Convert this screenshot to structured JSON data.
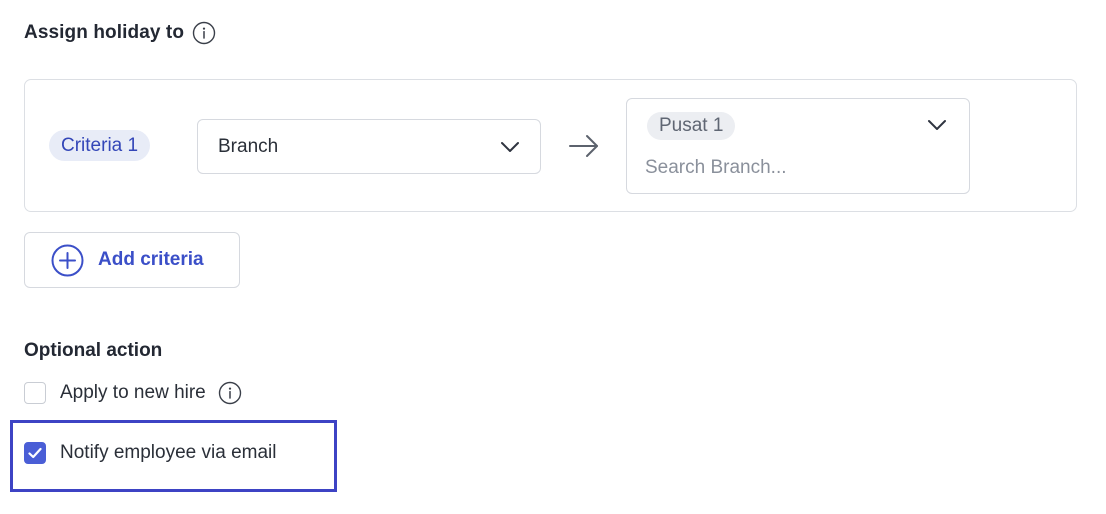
{
  "assign_section": {
    "title": "Assign holiday to"
  },
  "criteria": [
    {
      "tag_label": "Criteria 1",
      "field_value": "Branch",
      "selected_chips": [
        "Pusat 1"
      ],
      "search_placeholder": "Search Branch..."
    }
  ],
  "add_criteria_label": "Add criteria",
  "optional_section": {
    "title": "Optional action",
    "options": [
      {
        "label": "Apply to new hire",
        "checked": false
      },
      {
        "label": "Notify employee via email",
        "checked": true
      }
    ]
  },
  "icons": {
    "info": "info-icon",
    "chevron": "chevron-down-icon",
    "arrow": "arrow-right-icon",
    "plus": "plus-circle-icon",
    "check": "checkmark-icon"
  },
  "colors": {
    "accent": "#3b4fc8",
    "checkbox_checked": "#4a5ed6",
    "criteria_tag_bg": "#e8ecf7",
    "highlight": "#3d43c4"
  }
}
